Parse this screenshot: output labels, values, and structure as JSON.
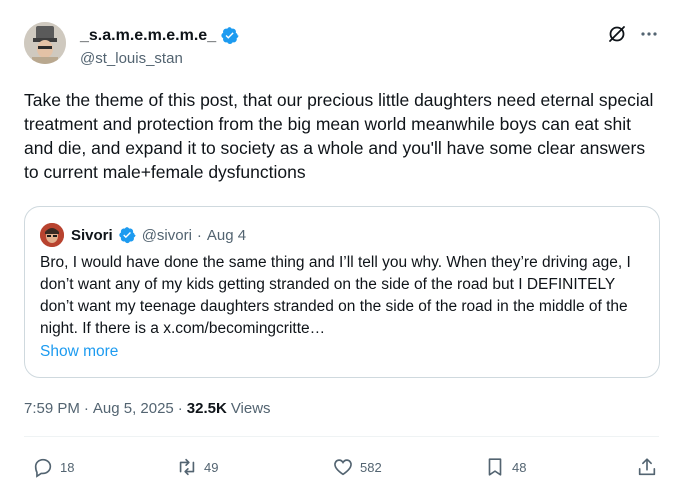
{
  "author": {
    "display_name": "_s.a.m.e.m.e.m.e_",
    "handle": "@st_louis_stan"
  },
  "post": {
    "text": "Take the theme of this post, that our precious little daughters need eternal special treatment and protection from the big mean world meanwhile boys can eat shit and die, and expand it to society as a whole and you'll have some clear answers to current male+female dysfunctions",
    "time": "7:59 PM",
    "date": "Aug 5, 2025",
    "views_count": "32.5K",
    "views_label": "Views"
  },
  "quote": {
    "display_name": "Sivori",
    "handle": "@sivori",
    "date": "Aug 4",
    "text": "Bro, I would have done the same thing and I’ll tell you why. When they’re driving age, I don’t want any of my kids getting stranded on the side of the road but I DEFINITELY don’t want my teenage daughters stranded on the side of the road in the middle of the night. If there is a x.com/becomingcritte…",
    "show_more": "Show more"
  },
  "actions": {
    "replies": "18",
    "reposts": "49",
    "likes": "582",
    "bookmarks": "48"
  },
  "colors": {
    "accent": "#1d9bf0",
    "text": "#0f1419",
    "muted": "#536471",
    "border": "#cfd9de"
  },
  "icons": [
    "verified-badge-icon",
    "grok-icon",
    "more-icon",
    "reply-icon",
    "repost-icon",
    "like-icon",
    "bookmark-icon",
    "share-icon"
  ]
}
